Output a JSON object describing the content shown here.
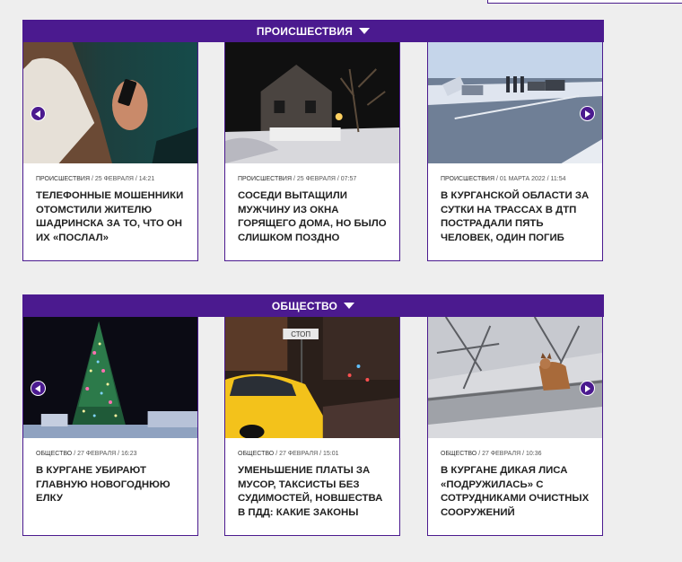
{
  "sections": [
    {
      "title": "ПРОИСШЕСТВИЯ",
      "cards": [
        {
          "category": "ПРОИСШЕСТВИЯ",
          "date": " / 25 ФЕВРАЛЯ / 14:21",
          "title": "ТЕЛЕФОННЫЕ МОШЕННИКИ ОТОМСТИЛИ ЖИТЕЛЮ ШАДРИНСКА ЗА ТО, ЧТО ОН ИХ «ПОСЛАЛ»"
        },
        {
          "category": "ПРОИСШЕСТВИЯ",
          "date": " / 25 ФЕВРАЛЯ / 07:57",
          "title": "СОСЕДИ ВЫТАЩИЛИ МУЖЧИНУ ИЗ ОКНА ГОРЯЩЕГО ДОМА, НО БЫЛО СЛИШКОМ ПОЗДНО"
        },
        {
          "category": "ПРОИСШЕСТВИЯ",
          "date": " / 01 МАРТА 2022 / 11:54",
          "title": "В КУРГАНСКОЙ ОБЛАСТИ ЗА СУТКИ НА ТРАССАХ В ДТП ПОСТРАДАЛИ ПЯТЬ ЧЕЛОВЕК, ОДИН ПОГИБ"
        }
      ]
    },
    {
      "title": "ОБЩЕСТВО",
      "cards": [
        {
          "category": "ОБЩЕСТВО",
          "date": " / 27 ФЕВРАЛЯ / 16:23",
          "title": "В КУРГАНЕ УБИРАЮТ ГЛАВНУЮ НОВОГОДНЮЮ ЕЛКУ"
        },
        {
          "category": "ОБЩЕСТВО",
          "date": " / 27 ФЕВРАЛЯ / 15:01",
          "title": "УМЕНЬШЕНИЕ ПЛАТЫ ЗА МУСОР, ТАКСИСТЫ БЕЗ СУДИМОСТЕЙ, НОВШЕСТВА В ПДД: КАКИЕ ЗАКОНЫ"
        },
        {
          "category": "ОБЩЕСТВО",
          "date": " / 27 ФЕВРАЛЯ / 10:36",
          "title": "В КУРГАНЕ ДИКАЯ ЛИСА «ПОДРУЖИЛАСЬ» С СОТРУДНИКАМИ ОЧИСТНЫХ СООРУЖЕНИЙ"
        }
      ]
    }
  ],
  "photo_texts": {
    "street_sign": "СТОП"
  },
  "colors": {
    "accent": "#4b1a8f",
    "background": "#eeeeee"
  }
}
